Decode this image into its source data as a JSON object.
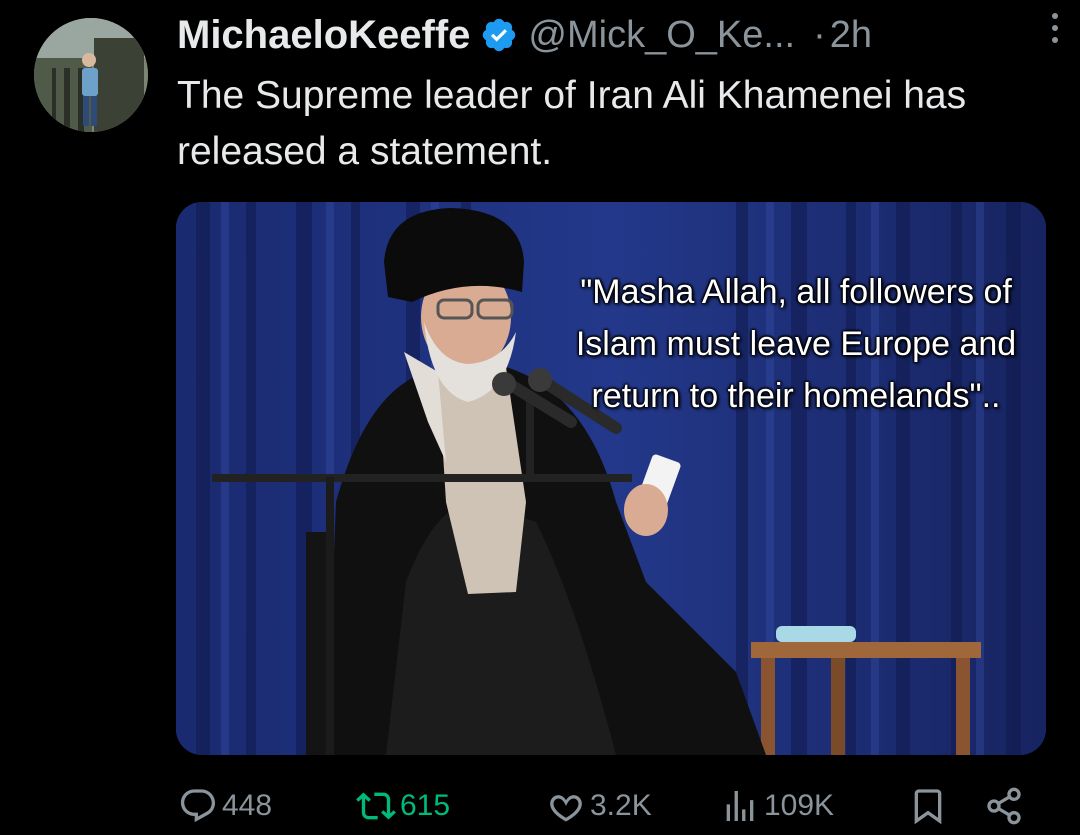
{
  "author": {
    "display_name": "MichaeloKeeffe",
    "handle": "@Mick_O_Ke...",
    "separator": "·",
    "time": "2h"
  },
  "tweet": {
    "text": "The Supreme leader of Iran Ali Khamenei has released a statement."
  },
  "media": {
    "quote": "\"Masha Allah, all followers of Islam must leave Europe and return to their homelands\".."
  },
  "actions": {
    "replies": "448",
    "retweets": "615",
    "likes": "3.2K",
    "views": "109K"
  },
  "colors": {
    "background": "#000000",
    "text": "#e7e9ea",
    "muted": "#8b949b",
    "verified": "#1d9bf0",
    "retweet_active": "#00ba7c",
    "curtain": "#1c2b6b"
  },
  "icons": {
    "verified": "verified-badge-icon",
    "more": "more-options-icon",
    "reply": "reply-icon",
    "retweet": "retweet-icon",
    "like": "heart-icon",
    "views": "views-chart-icon",
    "bookmark": "bookmark-icon",
    "share": "share-icon"
  }
}
